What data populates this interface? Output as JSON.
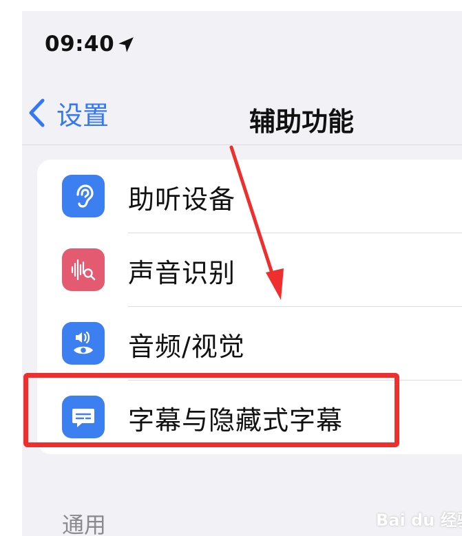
{
  "status_bar": {
    "time": "09:40",
    "location_icon": "location-arrow-icon"
  },
  "nav": {
    "back_label": "设置",
    "title": "辅助功能"
  },
  "list": {
    "items": [
      {
        "label": "助听设备",
        "icon": "hearing-device-icon",
        "color": "#3c7ff0"
      },
      {
        "label": "声音识别",
        "icon": "sound-recognition-icon",
        "color": "#e35a71"
      },
      {
        "label": "音频/视觉",
        "icon": "audio-visual-icon",
        "color": "#3c7ff0"
      },
      {
        "label": "字幕与隐藏式字幕",
        "icon": "subtitles-icon",
        "color": "#3c7ff0"
      }
    ]
  },
  "sections": {
    "general_header": "通用"
  },
  "annotations": {
    "highlight_color": "#ef2e2e"
  },
  "watermark": {
    "text": "Bai du 经验"
  }
}
